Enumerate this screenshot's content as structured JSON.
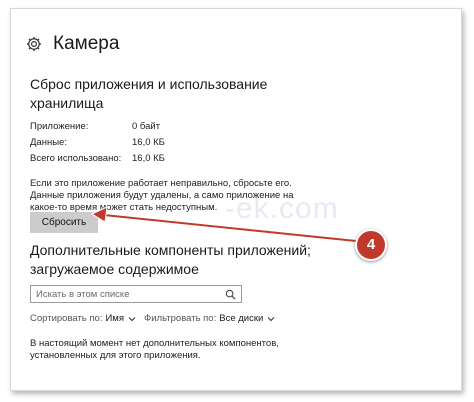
{
  "header": {
    "title": "Камера",
    "icon": "gear-icon"
  },
  "reset_section": {
    "title": "Сброс приложения и использование хранилища",
    "rows": [
      {
        "label": "Приложение:",
        "value": "0 байт"
      },
      {
        "label": "Данные:",
        "value": "16,0 КБ"
      },
      {
        "label": "Всего использовано:",
        "value": "16,0 КБ"
      }
    ],
    "description": "Если это приложение работает неправильно, сбросьте его. Данные приложения будут удалены, а само приложение на какое-то время может стать недоступным.",
    "reset_button": "Сбросить"
  },
  "components_section": {
    "title": "Дополнительные компоненты приложений; загружаемое содержимое",
    "search_placeholder": "Искать в этом списке",
    "sort_label": "Сортировать по:",
    "sort_value": "Имя",
    "filter_label": "Фильтровать по:",
    "filter_value": "Все диски",
    "empty_message": "В настоящий момент нет дополнительных компонентов, установленных для этого приложения."
  },
  "annotation": {
    "badge_number": "4",
    "badge_color": "#c0392b",
    "arrow_color": "#c0392b"
  },
  "watermark": "-ek.com"
}
